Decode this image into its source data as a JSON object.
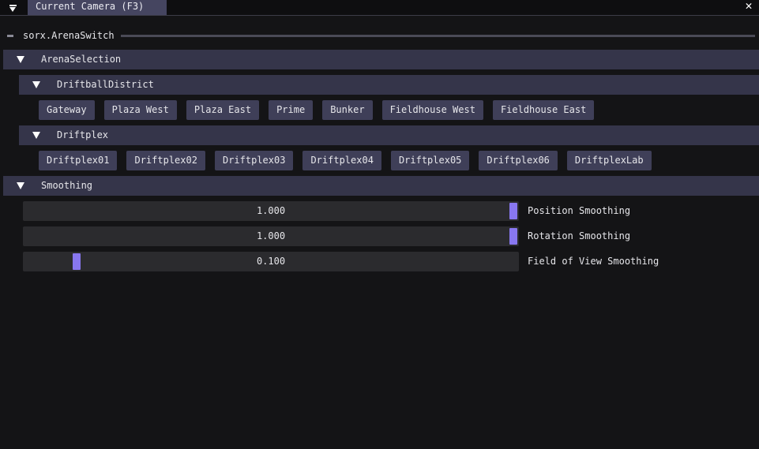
{
  "window": {
    "tab_title": "Current Camera (F3)",
    "close_glyph": "✕"
  },
  "separator": {
    "label": "sorx.ArenaSwitch"
  },
  "arena_selection": {
    "label": "ArenaSelection",
    "groups": [
      {
        "label": "DriftballDistrict",
        "buttons": [
          "Gateway",
          "Plaza West",
          "Plaza East",
          "Prime",
          "Bunker",
          "Fieldhouse West",
          "Fieldhouse East"
        ]
      },
      {
        "label": "Driftplex",
        "buttons": [
          "Driftplex01",
          "Driftplex02",
          "Driftplex03",
          "Driftplex04",
          "Driftplex05",
          "Driftplex06",
          "DriftplexLab"
        ]
      }
    ]
  },
  "smoothing": {
    "label": "Smoothing",
    "sliders": [
      {
        "label": "Position Smoothing",
        "value": 1.0,
        "display": "1.000",
        "min": 0,
        "max": 1
      },
      {
        "label": "Rotation Smoothing",
        "value": 1.0,
        "display": "1.000",
        "min": 0,
        "max": 1
      },
      {
        "label": "Field of View Smoothing",
        "value": 0.1,
        "display": "0.100",
        "min": 0,
        "max": 1
      }
    ]
  },
  "colors": {
    "accent": "#8877f0",
    "header_bg": "#35354a",
    "button_bg": "#3f3f58",
    "tab_active": "#454560",
    "window_bg": "#141416"
  }
}
